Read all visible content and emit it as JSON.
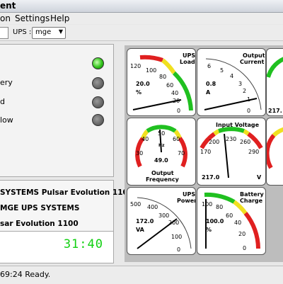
{
  "window": {
    "title": "ent"
  },
  "menu": {
    "items": [
      "on",
      "Settings",
      "Help"
    ]
  },
  "toolbar": {
    "ups_label": "UPS :",
    "ups_selected": "mge"
  },
  "leds": [
    {
      "label": "",
      "state": "on"
    },
    {
      "label": "ery",
      "state": "off"
    },
    {
      "label": "d",
      "state": "off"
    },
    {
      "label": "low",
      "state": "off"
    }
  ],
  "info": {
    "line1": "SYSTEMS Pulsar Evolution 1100",
    "line2": "MGE UPS SYSTEMS",
    "line3": "sar Evolution 1100"
  },
  "clock": {
    "time": "31:40"
  },
  "gauges": {
    "ups_load": {
      "title": [
        "UPS",
        "Load"
      ],
      "value_text": "20.0",
      "unit": "%",
      "ticks": [
        "120",
        "100",
        "80",
        "60",
        "40",
        "20",
        "0"
      ]
    },
    "output_current": {
      "title": [
        "Output",
        "Current"
      ],
      "value_text": "0.8",
      "unit": "A",
      "ticks": [
        "6",
        "5",
        "4",
        "3",
        "2",
        "1",
        "0"
      ]
    },
    "right_top": {
      "value_text": "217.",
      "unit": ""
    },
    "output_frequency": {
      "title": [
        "Output",
        "Frequency"
      ],
      "value_text": "49.0",
      "unit": "Hz",
      "ticks": [
        "30",
        "40",
        "50",
        "60",
        "70"
      ]
    },
    "input_voltage": {
      "title": [
        "Input Voltage"
      ],
      "value_text": "217.0",
      "unit": "V",
      "ticks": [
        "170",
        "200",
        "230",
        "260",
        "290"
      ]
    },
    "ups_power": {
      "title": [
        "UPS",
        "Power"
      ],
      "value_text": "172.0",
      "unit": "VA",
      "ticks": [
        "500",
        "400",
        "300",
        "200",
        "100",
        "0"
      ]
    },
    "battery_charge": {
      "title": [
        "Battery",
        "Charge"
      ],
      "value_text": "100.0",
      "unit": "%",
      "ticks": [
        "100",
        "80",
        "60",
        "40",
        "20",
        "0"
      ]
    }
  },
  "status": {
    "text": "69:24 Ready."
  }
}
